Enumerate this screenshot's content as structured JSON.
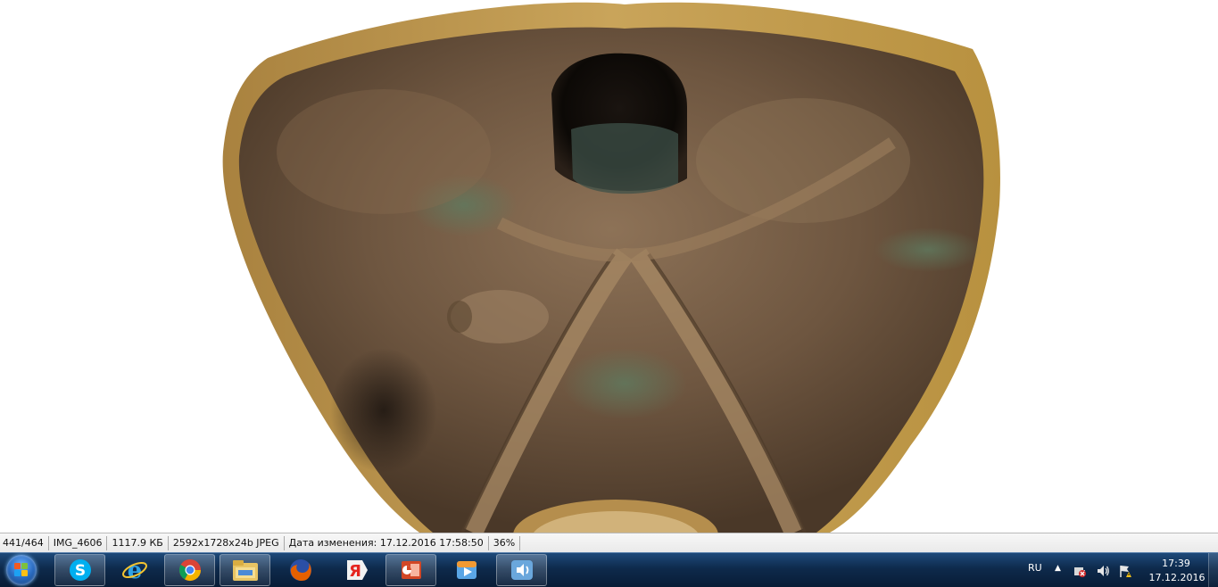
{
  "status_bar": {
    "index": "441/464",
    "filename": "IMG_4606",
    "filesize": "1117.9 КБ",
    "image_info": "2592x1728x24b JPEG",
    "modified": "Дата изменения: 17.12.2016 17:58:50",
    "zoom": "36%"
  },
  "taskbar": {
    "pinned_apps": [
      "skype-icon",
      "internet-explorer-icon",
      "chrome-icon",
      "file-explorer-icon",
      "firefox-icon",
      "yandex-browser-icon",
      "powerpoint-icon",
      "media-player-icon",
      "volume-app-icon"
    ],
    "language": "RU",
    "clock_time": "17:39",
    "clock_date": "17.12.2016"
  },
  "colors": {
    "taskbar": "#0e2a4c",
    "statusbar": "#efefef",
    "bronze": "#8a6a48"
  }
}
